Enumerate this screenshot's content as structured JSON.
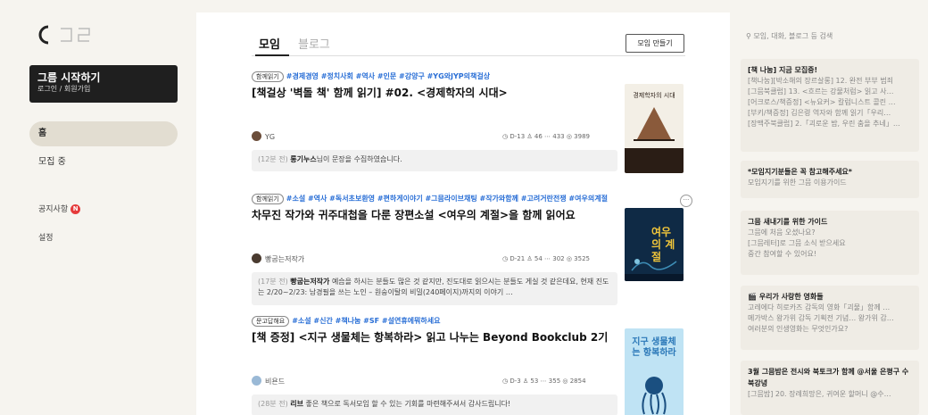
{
  "brand": {
    "logo_alt": "그름"
  },
  "sidebar": {
    "start_title": "그름 시작하기",
    "start_sub": "로그인 / 회원가입",
    "nav": [
      {
        "label": "홈",
        "active": true
      },
      {
        "label": "모집 중",
        "active": false
      }
    ],
    "notice_label": "공지사항",
    "notice_badge": "N",
    "settings_label": "설정"
  },
  "main": {
    "tabs": [
      {
        "label": "모임"
      },
      {
        "label": "블로그"
      }
    ],
    "create_button": "모임 만들기",
    "posts": [
      {
        "category": "함께읽기",
        "tags": "#경제경영 #정치사회 #역사 #인문 #강양구 #YG와JYP의책걸상",
        "title": "[책걸상 '벽돌 책' 함께 읽기] #02. <경제학자의 시대>",
        "author": "YG",
        "stats": "◷ D-13  ♙ 46  ⋯ 433  ◎ 3989",
        "activity_time": "(12분 전)",
        "activity_who": "롱기누스",
        "activity_text": "님이 문장을 수집하였습니다.",
        "book_title": "경제학자의 시대",
        "book_colors": {
          "bg": "#f3efe6",
          "accent": "#8a5a3b",
          "dark": "#2a1d15"
        }
      },
      {
        "category": "함께읽기",
        "tags": "#소설 #역사 #독서초보환영 #편하게이야기 #그믐라이브채팅 #작가와함께 #고려거란전쟁 #여우의계절",
        "title": "차무진 작가와 귀주대첩을 다룬 장편소설 <여우의 계절>을 함께 읽어요",
        "author": "빵굽는저작가",
        "stats": "◷ D-21  ♙ 54  ⋯ 302  ◎ 3525",
        "activity_time": "(17분 전)",
        "activity_who": "빵굽는저작가",
        "activity_text": " 예습을 하시는 분들도 많은 것 같지만, 진도대로 읽으시는 분들도 게실 것 같은데요, 현재 진도는 2/20~2/23: 남경필을 쓰는 노인 – 원숭이탈의 비밀(240페이지)까지의 이야기 …",
        "book_title": "여우의 계절",
        "book_colors": {
          "bg": "#0f2a45",
          "accent": "#f0c53a",
          "dark": "#08182b"
        }
      },
      {
        "category": "문고답해요",
        "tags": "#소설 #신간 #책나눔 #SF #설연휴에뭐하세요",
        "title": "[책 증정] <지구 생물체는 항복하라> 읽고 나누는 Beyond Bookclub 2기",
        "author": "비욘드",
        "stats": "◷ D-3  ♙ 53  ⋯ 355  ◎ 2854",
        "activity_time": "(28분 전)",
        "activity_who": "리브",
        "activity_text": " 좋은 책으로 독서모임 할 수 있는 기회를 마련해주셔서 감사드립니다!",
        "book_title": "지구 생물체는 항복하라",
        "book_colors": {
          "bg": "#bfe3f4",
          "accent": "#2b78b8",
          "dark": "#1a4f80"
        }
      }
    ]
  },
  "right": {
    "search_placeholder": "모임, 대화, 블로그 등 검색",
    "cards": [
      {
        "title": "[책 나눔] 지금 모집중!",
        "lines": [
          "[책나눔][박소해의 장르살롱] 12. 완전 부부 범죄",
          "[그믐북클럽] 13. <흐르는 강물처럼> 읽고 사…",
          "[어크로스/책증정] <뉴요커> 칼럼니스트 콜린 …",
          "[부키/책증정] 김은령 역자와 함께 읽기「우리…",
          "[장맥주북클럽] 2.「괴로운 밤, 우린 춤을 추네」…"
        ]
      },
      {
        "title": "*모임지기분들은 꼭 참고해주세요*",
        "lines": [
          "모임지기를 위한 그믐 이용가이드"
        ]
      },
      {
        "title": "그믐 새내기를 위한 가이드",
        "lines": [
          "그믐에 처음 오셨나요?",
          "[그믐레터]로 그믐 소식 받으세요",
          "중간 참여할 수 있어요!"
        ]
      },
      {
        "title": "🎬 우리가 사랑한 영화들",
        "lines": [
          "고레에다 히로카즈 감독의 영화「괴물」함께 …",
          "메가박스 왕가위 감독 기획전 기념… 왕가위 감…",
          "여러분의 인생영화는 무엇인가요?"
        ]
      },
      {
        "title": "3월 그믐밤은 전시와 북토크가 함께 @서울 은평구 수북강녕",
        "lines": [
          "[그믐밤] 20. 장례희망은, 귀여운 할머니 @수…"
        ]
      }
    ]
  }
}
